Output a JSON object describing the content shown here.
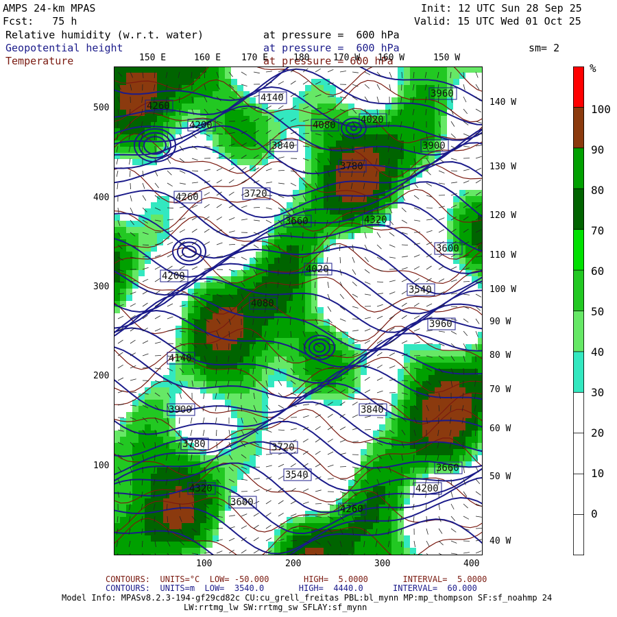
{
  "header": {
    "model": "AMPS 24-km MPAS",
    "fcst": "Fcst:   75 h",
    "init": "Init: 12 UTC Sun 28 Sep 25",
    "valid": "Valid: 15 UTC Wed 01 Oct 25",
    "field1_name": "Relative humidity (w.r.t. water)",
    "field1_level": "at pressure =  600 hPa",
    "field2_name": "Geopotential height",
    "field2_level": "at pressure =  600 hPa",
    "smoothing": "sm= 2",
    "field3_name": "Temperature",
    "field3_level": "at pressure = 600 hPa"
  },
  "map": {
    "top_lon_labels": [
      "150 E",
      "160 E",
      "170 E",
      "180",
      "170 W",
      "160 W",
      "150 W"
    ],
    "right_lon_labels": [
      "140 W",
      "130 W",
      "120 W",
      "110 W",
      "100 W",
      "90 W",
      "80 W",
      "70 W",
      "60 W",
      "50 W",
      "40 W"
    ],
    "y_ticks": [
      "500",
      "400",
      "300",
      "200",
      "100"
    ],
    "x_ticks": [
      "100",
      "200",
      "300",
      "400"
    ],
    "height_labels": [
      "4260",
      "4200",
      "4140",
      "4080",
      "4020",
      "3960",
      "3900",
      "3840",
      "3780",
      "3720",
      "3660",
      "4320",
      "3600",
      "3540"
    ]
  },
  "colorbar": {
    "unit": "%",
    "labels": [
      "100",
      "90",
      "80",
      "70",
      "60",
      "50",
      "40",
      "30",
      "20",
      "10",
      "0"
    ],
    "colors": [
      "#ff0000",
      "#8b3a0e",
      "#00a000",
      "#006400",
      "#00e000",
      "#22c822",
      "#66e866",
      "#33e8c0",
      "#ffffff",
      "#ffffff",
      "#ffffff",
      "#ffffff"
    ]
  },
  "footer": {
    "temp_contours": "CONTOURS:  UNITS=°C  LOW= -50.000       HIGH=  5.0000       INTERVAL=  5.0000",
    "hgt_contours": "CONTOURS:  UNITS=m  LOW=  3540.0       HIGH=  4440.0      INTERVAL=  60.000",
    "model_info": "Model Info: MPASv8.2.3-194-gf29cd82c CU:cu_grell_freitas PBL:bl_mynn MP:mp_thompson SF:sf_noahmp 24",
    "model_info2": "LW:rrtmg_lw SW:rrtmg_sw SFLAY:sf_mynn"
  }
}
